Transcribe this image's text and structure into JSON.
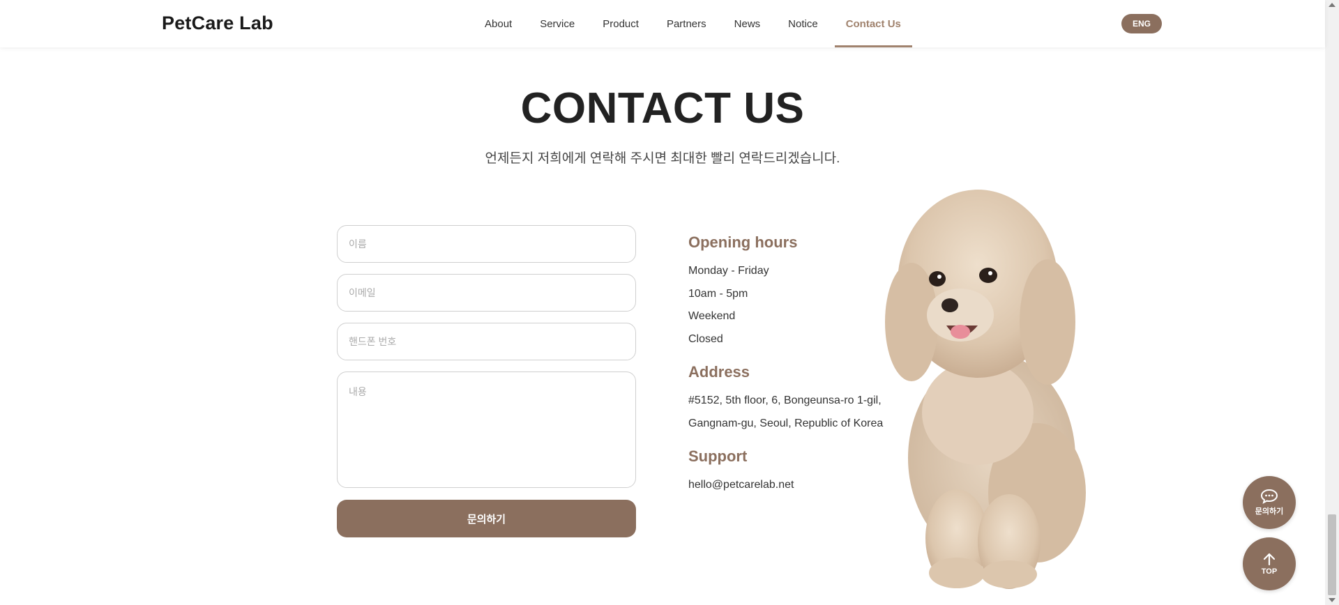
{
  "header": {
    "logo_text": "etCare Lab",
    "logo_initial": "P",
    "nav": [
      "About",
      "Service",
      "Product",
      "Partners",
      "News",
      "Notice",
      "Contact Us"
    ],
    "active_nav": "Contact Us",
    "lang_label": "ENG"
  },
  "hero": {
    "title": "CONTACT US",
    "subtitle": "언제든지 저희에게 연락해 주시면 최대한 빨리 연락드리겠습니다."
  },
  "form": {
    "name_placeholder": "이름",
    "email_placeholder": "이메일",
    "phone_placeholder": "핸드폰 번호",
    "message_placeholder": "내용",
    "submit_label": "문의하기"
  },
  "info": {
    "opening_title": "Opening hours",
    "opening_lines": [
      "Monday - Friday",
      "10am - 5pm",
      "Weekend",
      "Closed"
    ],
    "address_title": "Address",
    "address_lines": [
      "#5152, 5th floor, 6, Bongeunsa-ro 1-gil,",
      "Gangnam-gu, Seoul, Republic of Korea"
    ],
    "support_title": "Support",
    "support_email": "hello@petcarelab.net"
  },
  "floating": {
    "inquiry_label": "문의하기",
    "top_label": "TOP"
  },
  "colors": {
    "brand": "#8b6f5e",
    "active_nav": "#a0826d"
  },
  "icons": [
    "paw-icon",
    "chat-bubble-icon",
    "arrow-up-icon",
    "poodle-dog-illustration"
  ]
}
